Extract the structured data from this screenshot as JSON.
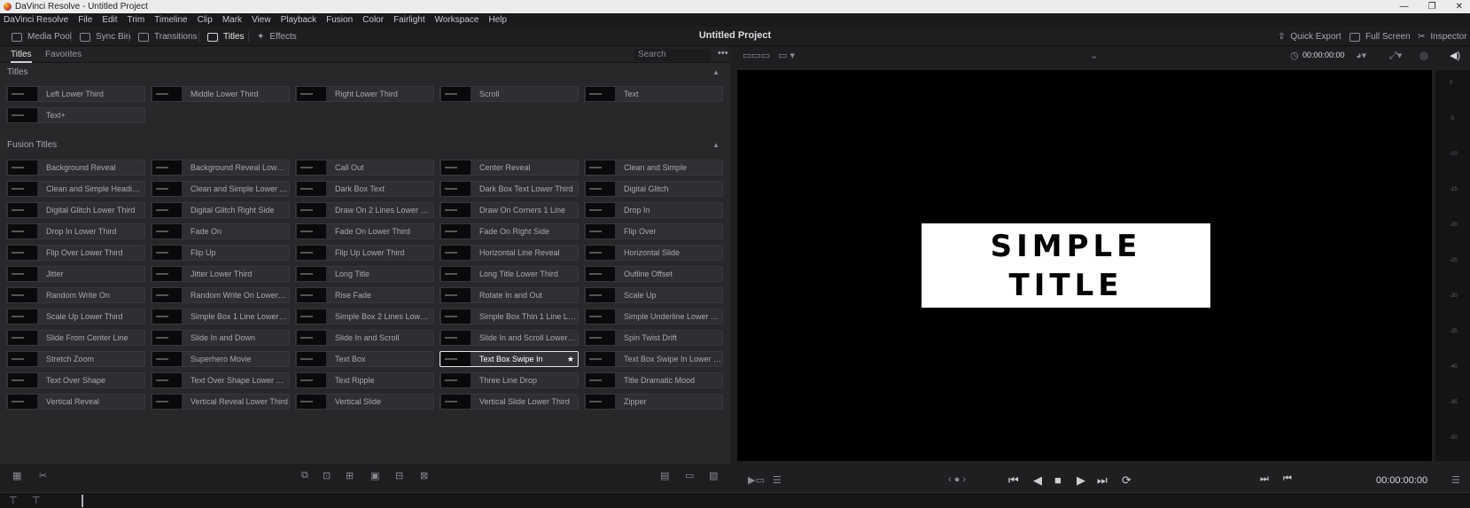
{
  "window": {
    "title": "DaVinci Resolve - Untitled Project",
    "controls": [
      "—",
      "❐",
      "✕"
    ]
  },
  "menu": [
    "DaVinci Resolve",
    "File",
    "Edit",
    "Trim",
    "Timeline",
    "Clip",
    "Mark",
    "View",
    "Playback",
    "Fusion",
    "Color",
    "Fairlight",
    "Workspace",
    "Help"
  ],
  "toolbar": {
    "media_pool": "Media Pool",
    "sync_bin": "Sync Bin",
    "transitions": "Transitions",
    "titles": "Titles",
    "effects": "Effects",
    "project_title": "Untitled Project",
    "quick_export": "Quick Export",
    "full_screen": "Full Screen",
    "inspector": "Inspector"
  },
  "panel": {
    "tab_titles": "Titles",
    "tab_favorites": "Favorites",
    "search_placeholder": "Search",
    "section_titles": "Titles",
    "section_fusion": "Fusion Titles"
  },
  "titles": [
    "Left Lower Third",
    "Middle Lower Third",
    "Right Lower Third",
    "Scroll",
    "Text",
    "Text+"
  ],
  "fusion_titles": [
    "Background Reveal",
    "Background Reveal Lower T...",
    "Call Out",
    "Center Reveal",
    "Clean and Simple",
    "Clean and Simple Heading ...",
    "Clean and Simple Lower Th...",
    "Dark Box Text",
    "Dark Box Text Lower Third",
    "Digital Glitch",
    "Digital Glitch Lower Third",
    "Digital Glitch Right Side",
    "Draw On 2 Lines Lower Third",
    "Draw On Corners 1 Line",
    "Drop In",
    "Drop In Lower Third",
    "Fade On",
    "Fade On Lower Third",
    "Fade On Right Side",
    "Flip Over",
    "Flip Over Lower Third",
    "Flip Up",
    "Flip Up Lower Third",
    "Horizontal Line Reveal",
    "Horizontal Slide",
    "Jitter",
    "Jitter Lower Third",
    "Long Title",
    "Long Title Lower Third",
    "Outline Offset",
    "Random Write On",
    "Random Write On Lower T...",
    "Rise Fade",
    "Rotate In and Out",
    "Scale Up",
    "Scale Up Lower Third",
    "Simple Box 1 Line Lower Th...",
    "Simple Box 2 Lines Lower T...",
    "Simple Box Thin 1 Line Low...",
    "Simple Underline Lower Thi...",
    "Slide From Center Line",
    "Slide In and Down",
    "Slide In and Scroll",
    "Slide In and Scroll Lower Th...",
    "Spin Twist Drift",
    "Stretch Zoom",
    "Superhero Movie",
    "Text Box",
    "Text Box Swipe In",
    "Text Box Swipe In Lower Th...",
    "Text Over Shape",
    "Text Over Shape Lower Third",
    "Text Ripple",
    "Three Line Drop",
    "Title Dramatic Mood",
    "Vertical Reveal",
    "Vertical Reveal Lower Third",
    "Vertical Slide",
    "Vertical Slide Lower Third",
    "Zipper"
  ],
  "selected_title": "Text Box Swipe In",
  "viewer": {
    "timecode_top": "00:00:00:00",
    "timecode_bottom": "00:00:00:00",
    "card_line1": "SIMPLE",
    "card_line2": "TITLE"
  },
  "meter_ticks": [
    "0",
    "-5",
    "-10",
    "-15",
    "-20",
    "-25",
    "-30",
    "-35",
    "-40",
    "-45",
    "-50"
  ]
}
